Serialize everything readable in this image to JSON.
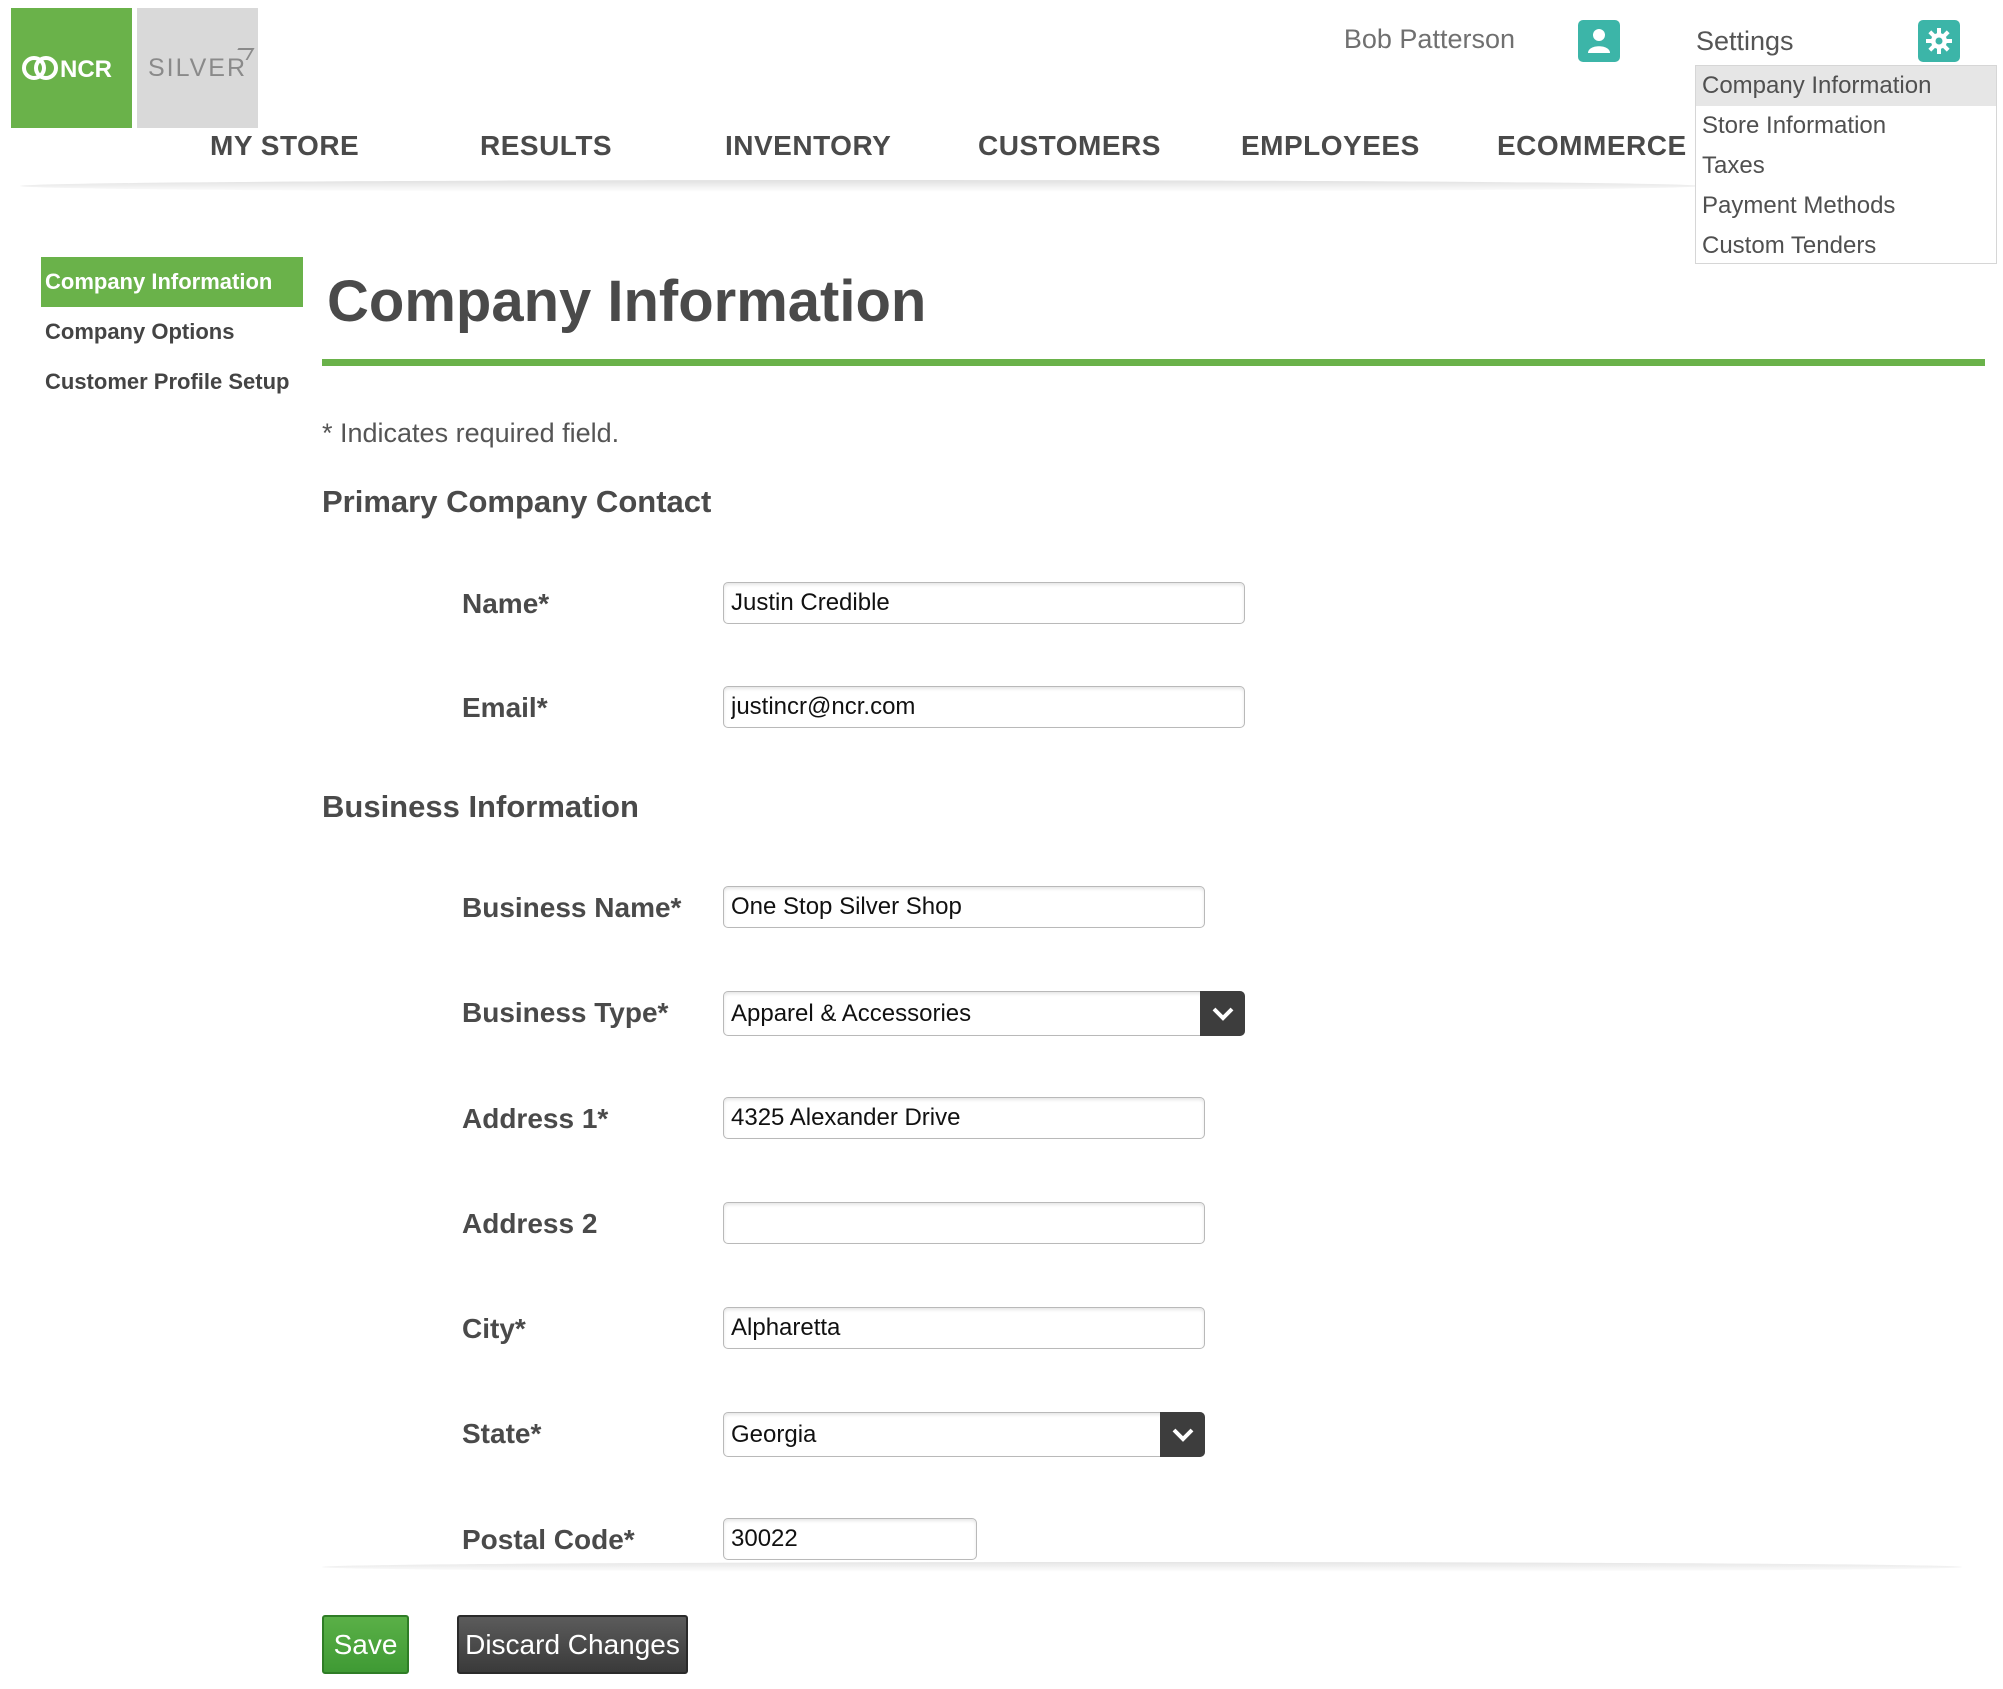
{
  "header": {
    "brand": "NCR",
    "product": "SILVER",
    "user_name": "Bob Patterson",
    "user_icon": "user-avatar-icon",
    "settings_label": "Settings",
    "settings_icon": "gear-icon",
    "accent_color": "#6ab24a",
    "icon_color": "#3cb5a8"
  },
  "settings_menu": {
    "items": [
      {
        "label": "Company Information"
      },
      {
        "label": "Store Information"
      },
      {
        "label": "Taxes"
      },
      {
        "label": "Payment Methods"
      },
      {
        "label": "Custom Tenders"
      }
    ],
    "active": "Company Information"
  },
  "nav": {
    "tabs": [
      {
        "label": "MY STORE"
      },
      {
        "label": "RESULTS"
      },
      {
        "label": "INVENTORY"
      },
      {
        "label": "CUSTOMERS"
      },
      {
        "label": "EMPLOYEES"
      },
      {
        "label": "ECOMMERCE"
      }
    ]
  },
  "sidebar": {
    "items": [
      {
        "label": "Company Information"
      },
      {
        "label": "Company Options"
      },
      {
        "label": "Customer Profile Setup"
      }
    ],
    "active": "Company Information"
  },
  "main": {
    "title": "Company Information",
    "required_note": "* Indicates required field.",
    "primary_contact": {
      "heading": "Primary Company Contact",
      "name_label": "Name*",
      "name_value": "Justin Credible",
      "email_label": "Email*",
      "email_value": "justincr@ncr.com"
    },
    "business_info": {
      "heading": "Business Information",
      "business_name_label": "Business Name*",
      "business_name_value": "One Stop Silver Shop",
      "business_type_label": "Business Type*",
      "business_type_value": "Apparel & Accessories",
      "address1_label": "Address 1*",
      "address1_value": "4325 Alexander Drive",
      "address2_label": "Address 2",
      "address2_value": "",
      "city_label": "City*",
      "city_value": "Alpharetta",
      "state_label": "State*",
      "state_value": "Georgia",
      "postal_label": "Postal Code*",
      "postal_value": "30022"
    },
    "buttons": {
      "save": "Save",
      "discard": "Discard Changes"
    }
  }
}
